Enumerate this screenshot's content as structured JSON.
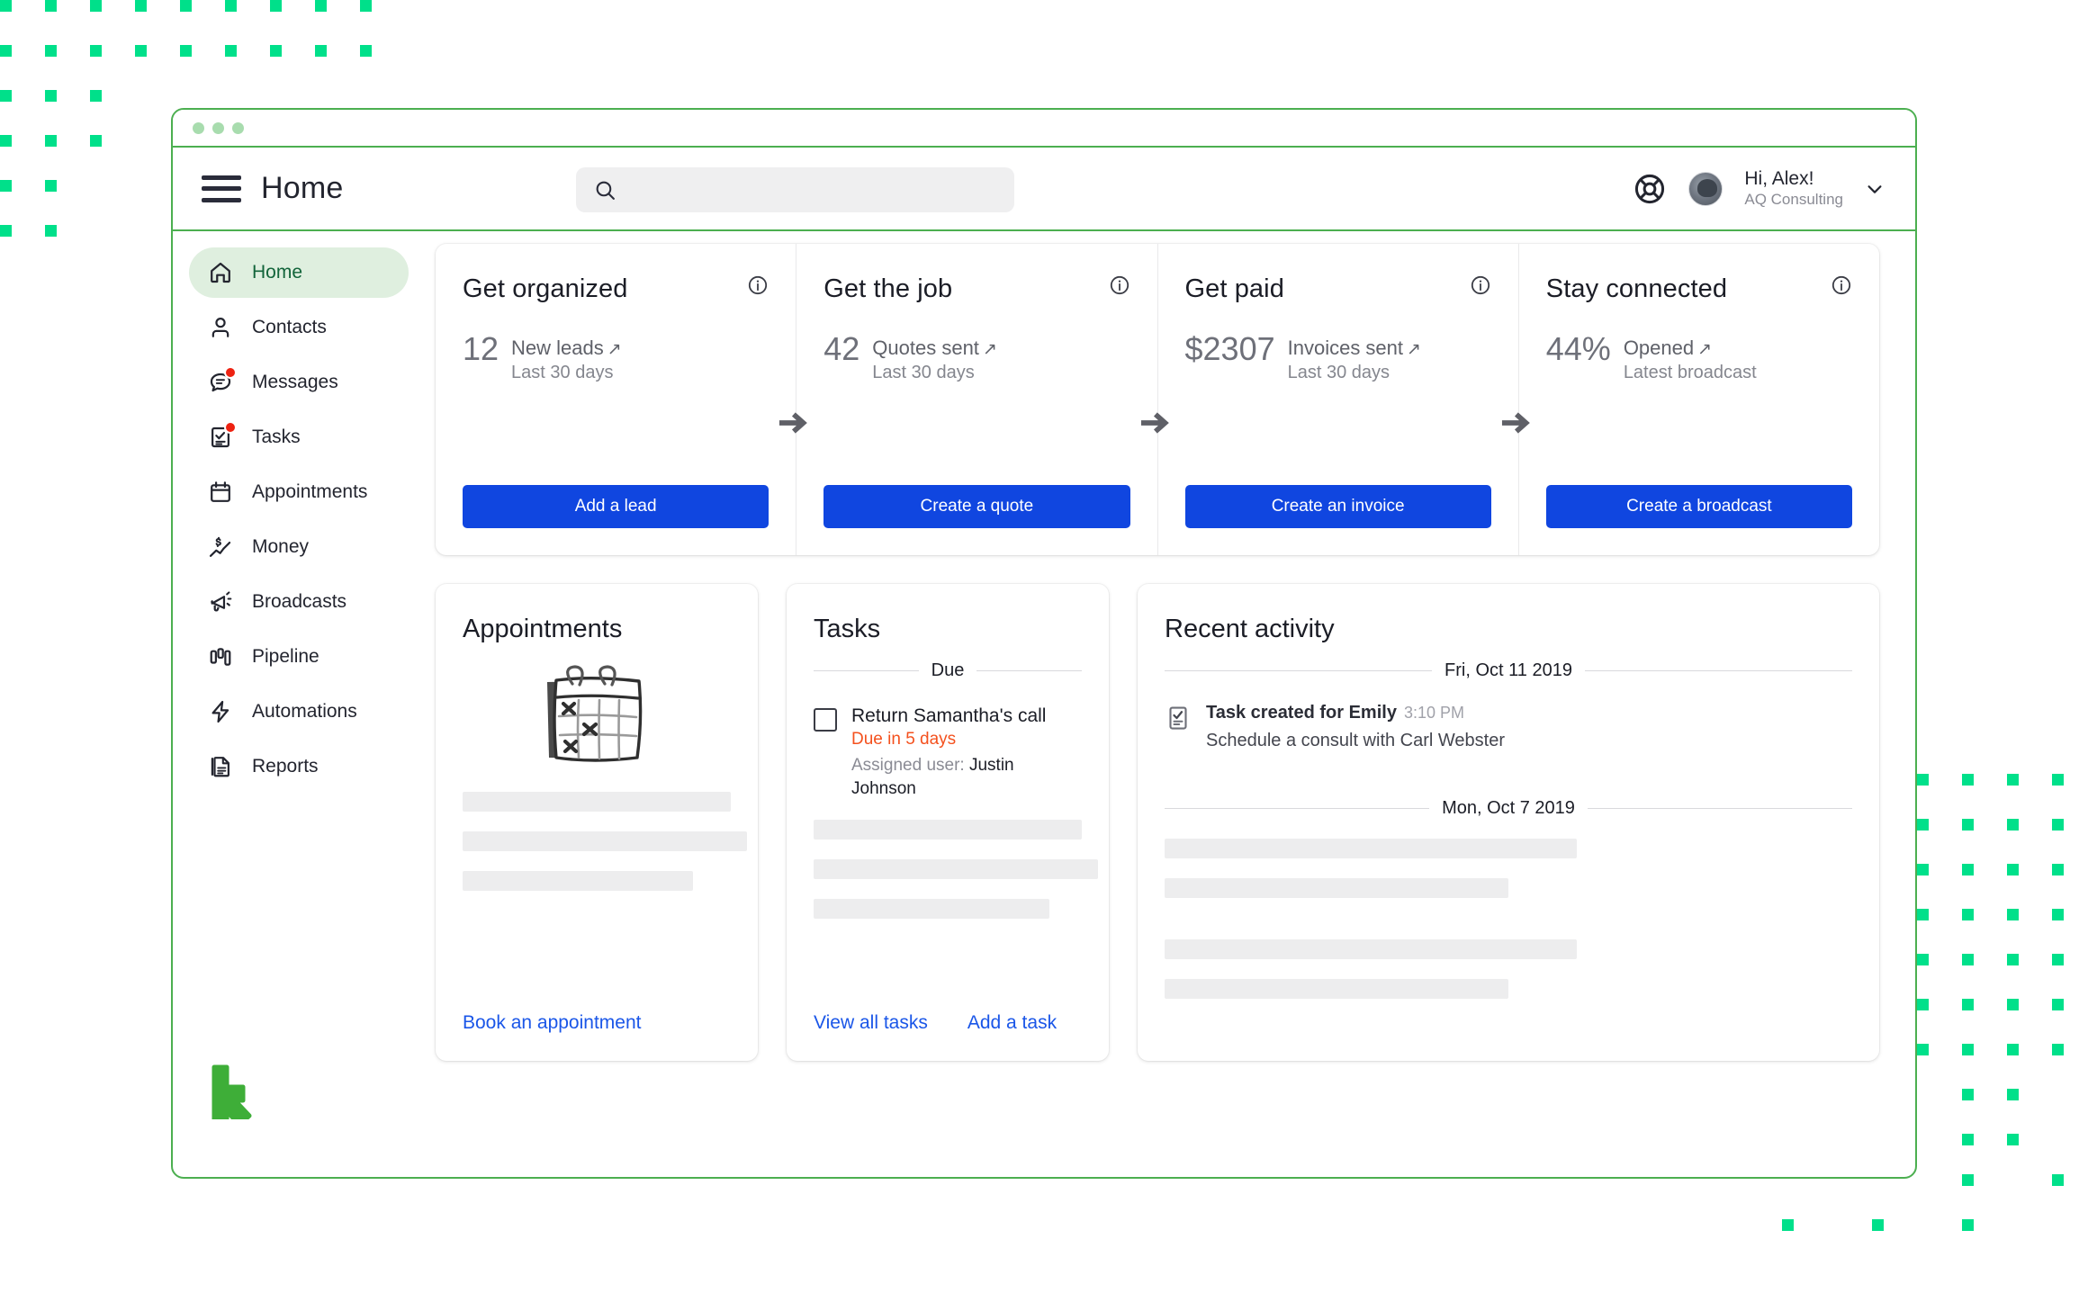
{
  "window": {
    "title_dots": 3
  },
  "header": {
    "page_title": "Home",
    "menu_icon": "hamburger-menu-icon",
    "search": {
      "value": "",
      "placeholder": "",
      "icon": "search-icon"
    },
    "help_icon": "lifebuoy-help-icon",
    "user": {
      "greeting": "Hi, Alex!",
      "org": "AQ Consulting",
      "avatar": "user-avatar",
      "chevron": "chevron-down-icon"
    }
  },
  "sidebar": {
    "items": [
      {
        "label": "Home",
        "icon": "home-icon",
        "active": true,
        "badge": false
      },
      {
        "label": "Contacts",
        "icon": "person-icon",
        "active": false,
        "badge": false
      },
      {
        "label": "Messages",
        "icon": "chat-bubble-icon",
        "active": false,
        "badge": true
      },
      {
        "label": "Tasks",
        "icon": "clipboard-check-icon",
        "active": false,
        "badge": true
      },
      {
        "label": "Appointments",
        "icon": "calendar-icon",
        "active": false,
        "badge": false
      },
      {
        "label": "Money",
        "icon": "money-trend-icon",
        "active": false,
        "badge": false
      },
      {
        "label": "Broadcasts",
        "icon": "megaphone-icon",
        "active": false,
        "badge": false
      },
      {
        "label": "Pipeline",
        "icon": "pipeline-bars-icon",
        "active": false,
        "badge": false
      },
      {
        "label": "Automations",
        "icon": "lightning-bolt-icon",
        "active": false,
        "badge": false
      },
      {
        "label": "Reports",
        "icon": "document-report-icon",
        "active": false,
        "badge": false
      }
    ],
    "logo": "keap-logo"
  },
  "metrics": [
    {
      "title": "Get organized",
      "value": "12",
      "stat_label": "New leads",
      "stat_sub": "Last 30 days",
      "button": "Add a lead",
      "info_icon": "info-icon",
      "link_arrow": "↗"
    },
    {
      "title": "Get the job",
      "value": "42",
      "stat_label": "Quotes sent",
      "stat_sub": "Last 30 days",
      "button": "Create a quote",
      "info_icon": "info-icon",
      "link_arrow": "↗"
    },
    {
      "title": "Get paid",
      "value": "$2307",
      "stat_label": "Invoices sent",
      "stat_sub": "Last 30 days",
      "button": "Create an invoice",
      "info_icon": "info-icon",
      "link_arrow": "↗"
    },
    {
      "title": "Stay connected",
      "value": "44%",
      "stat_label": "Opened",
      "stat_sub": "Latest broadcast",
      "button": "Create a broadcast",
      "info_icon": "info-icon",
      "link_arrow": "↗"
    }
  ],
  "appointments": {
    "title": "Appointments",
    "illustration": "calendar-sketch-illustration",
    "link": "Book an appointment",
    "skeleton_widths": [
      "100%",
      "106%",
      "86%"
    ]
  },
  "tasks": {
    "title": "Tasks",
    "section_label": "Due",
    "item": {
      "name": "Return Samantha's call",
      "due": "Due in 5 days",
      "assigned_prefix": "Assigned user:",
      "assigned_user": "Justin Johnson",
      "checkbox": "task-checkbox"
    },
    "links": [
      "View all tasks",
      "Add a task"
    ],
    "skeleton_widths": [
      "100%",
      "106%",
      "88%"
    ]
  },
  "activity": {
    "title": "Recent activity",
    "groups": [
      {
        "date": "Fri, Oct 11 2019",
        "entries": [
          {
            "icon": "task-created-icon",
            "title": "Task created for Emily",
            "time": "3:10 PM",
            "detail": "Schedule a consult with Carl Webster"
          }
        ]
      },
      {
        "date": "Mon, Oct 7 2019",
        "entries": []
      }
    ],
    "skeleton_widths": [
      "60%",
      "50%",
      "60%",
      "50%"
    ]
  },
  "colors": {
    "window_border_green": "#4CAF50",
    "accent_blue": "#1046E0",
    "link_blue": "#1A56E8",
    "due_red": "#F4511E",
    "badge_red": "#EE2211",
    "dot_green": "#00E08A",
    "keap_green": "#3EAE38",
    "active_nav_bg": "#DFEFDF",
    "active_nav_text": "#12643A"
  }
}
